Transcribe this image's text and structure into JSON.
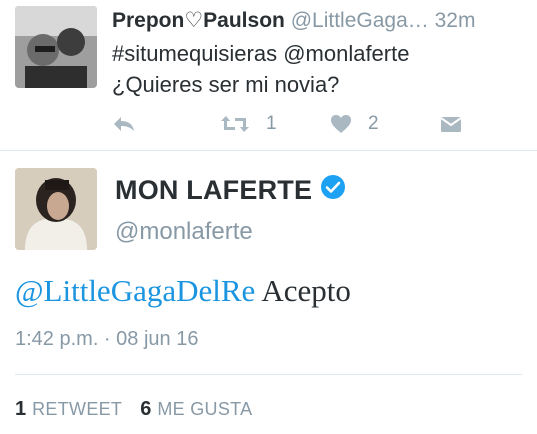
{
  "reply_tweet": {
    "name": "Prepon♡Paulson",
    "handle": "@LittleGaga…",
    "time": "32m",
    "text_line1": "#situmequisieras @monlaferte",
    "text_line2": "¿Quieres ser mi novia?",
    "retweet_count": "1",
    "like_count": "2",
    "icons": [
      "reply-icon",
      "retweet-icon",
      "heart-icon",
      "message-icon"
    ]
  },
  "main_tweet": {
    "name": "MON LAFERTE",
    "verified": true,
    "handle": "@monlaferte",
    "mention": "@LittleGagaDelRe",
    "text": "Acepto",
    "timestamp": "1:42 p.m. · 08 jun 16",
    "retweets": {
      "count": "1",
      "label": "RETWEET"
    },
    "likes": {
      "count": "6",
      "label": "ME GUSTA"
    }
  },
  "colors": {
    "link": "#1b95e0",
    "muted": "#8899a6",
    "text": "#292f33",
    "icon": "#aab8c2",
    "divider": "#e1e8ed"
  }
}
